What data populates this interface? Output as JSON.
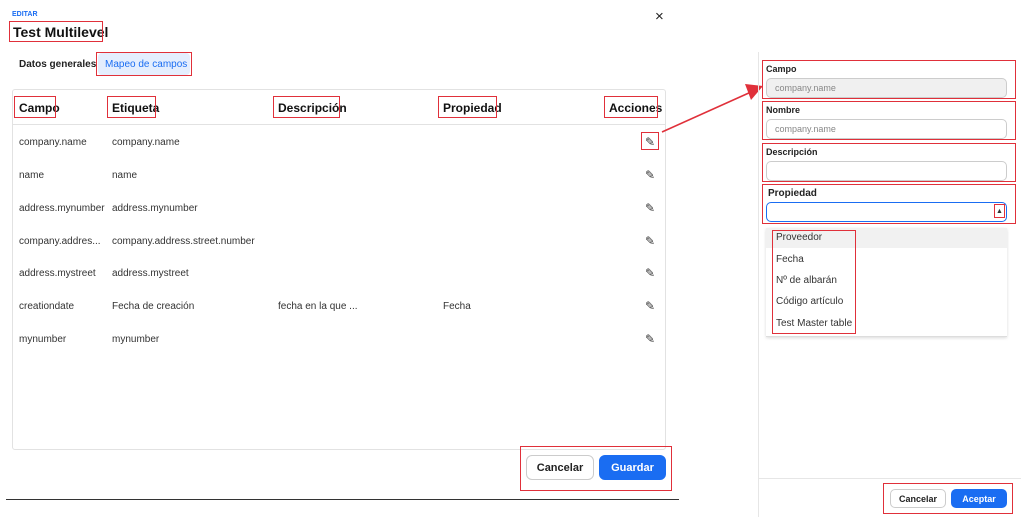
{
  "dialog": {
    "breadcrumb": "EDITAR",
    "title": "Test Multilevel",
    "close_glyph": "×",
    "tabs": [
      {
        "label": "Datos generales",
        "active": false
      },
      {
        "label": "Mapeo de campos",
        "active": true
      }
    ],
    "table": {
      "headers": [
        "Campo",
        "Etiqueta",
        "Descripción",
        "Propiedad",
        "Acciones"
      ],
      "rows": [
        {
          "campo": "company.name",
          "etiqueta": "company.name",
          "descripcion": "",
          "propiedad": ""
        },
        {
          "campo": "name",
          "etiqueta": "name",
          "descripcion": "",
          "propiedad": ""
        },
        {
          "campo": "address.mynumber",
          "etiqueta": "address.mynumber",
          "descripcion": "",
          "propiedad": ""
        },
        {
          "campo": "company.addres...",
          "etiqueta": "company.address.street.number",
          "descripcion": "",
          "propiedad": ""
        },
        {
          "campo": "address.mystreet",
          "etiqueta": "address.mystreet",
          "descripcion": "",
          "propiedad": ""
        },
        {
          "campo": "creationdate",
          "etiqueta": "Fecha de creación",
          "descripcion": "fecha en la que ...",
          "propiedad": "Fecha"
        },
        {
          "campo": "mynumber",
          "etiqueta": "mynumber",
          "descripcion": "",
          "propiedad": ""
        }
      ],
      "edit_icon": "pencil-icon"
    },
    "cancel_label": "Cancelar",
    "save_label": "Guardar"
  },
  "side_panel": {
    "campo_label": "Campo",
    "campo_value": "company.name",
    "nombre_label": "Nombre",
    "nombre_value": "company.name",
    "descripcion_label": "Descripción",
    "descripcion_value": "",
    "propiedad_label": "Propiedad",
    "propiedad_value": "",
    "options": [
      "Proveedor",
      "Fecha",
      "Nº de albarán",
      "Código artículo",
      "Test Master table"
    ],
    "cancel_label": "Cancelar",
    "accept_label": "Aceptar"
  },
  "colors": {
    "accent": "#1a6df2",
    "annotation": "#e0303a"
  }
}
